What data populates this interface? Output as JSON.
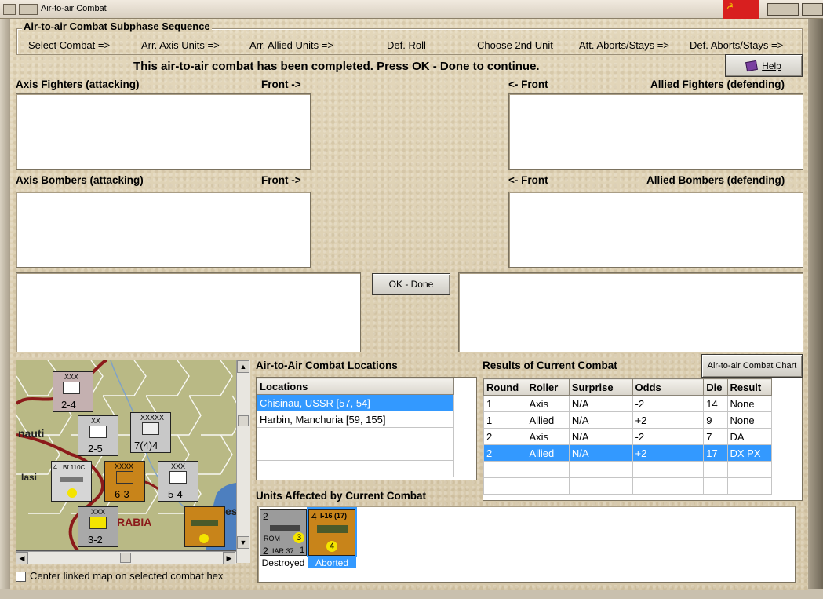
{
  "window": {
    "title": "Air-to-air Combat"
  },
  "sequence": {
    "title": "Air-to-air Combat Subphase Sequence",
    "steps": [
      "Select Combat =>",
      "Arr. Axis Units =>",
      "Arr. Allied Units =>",
      "Def. Roll",
      "Choose 2nd Unit",
      "Att. Aborts/Stays =>",
      "Def. Aborts/Stays =>"
    ]
  },
  "status_message": "This air-to-air combat has been completed.  Press OK - Done to continue.",
  "help_button": "Help",
  "sections": {
    "axis_fighters": "Axis Fighters (attacking)",
    "axis_bombers": "Axis Bombers (attacking)",
    "allied_fighters": "Allied Fighters (defending)",
    "allied_bombers": "Allied Bombers (defending)",
    "front_right": "Front ->",
    "front_left": "<- Front"
  },
  "ok_button": "OK - Done",
  "locations": {
    "title": "Air-to-Air Combat Locations",
    "header": "Locations",
    "rows": [
      "Chisinau, USSR [57, 54]",
      "Harbin, Manchuria [59, 155]"
    ]
  },
  "results": {
    "title": "Results of Current Combat",
    "chart_button": "Air-to-air Combat Chart",
    "headers": [
      "Round",
      "Roller",
      "Surprise",
      "Odds",
      "Die",
      "Result"
    ],
    "rows": [
      [
        "1",
        "Axis",
        "N/A",
        "-2",
        "14",
        "None"
      ],
      [
        "1",
        "Allied",
        "N/A",
        "+2",
        "9",
        "None"
      ],
      [
        "2",
        "Axis",
        "N/A",
        "-2",
        "7",
        "DA"
      ],
      [
        "2",
        "Allied",
        "N/A",
        "+2",
        "17",
        "DX PX"
      ]
    ]
  },
  "affected": {
    "title": "Units Affected by Current Combat",
    "units": [
      {
        "top_left": "2",
        "nation": "ROM",
        "value": "3",
        "bottom": "2",
        "name": "IAR 37",
        "bottom_right": "1",
        "caption": "Destroyed"
      },
      {
        "top_left": "4",
        "name": "I-16 (17)",
        "value": "4",
        "caption": "Aborted"
      }
    ]
  },
  "map": {
    "labels": [
      "nauti",
      "Iasi",
      "RABIA",
      "es"
    ],
    "counters": [
      {
        "value": "2-4",
        "tag": "XXX"
      },
      {
        "value": "2-5",
        "tag": "XX"
      },
      {
        "value": "7(4)4",
        "tag": "XXXXX"
      },
      {
        "value": "6-3",
        "tag": "XXXX"
      },
      {
        "value": "5-4",
        "tag": "XXX"
      },
      {
        "value": "3-2",
        "tag": "XXX"
      },
      {
        "value": "Bf 110C",
        "tag": "4"
      }
    ]
  },
  "center_checkbox": "Center linked map on selected combat hex"
}
